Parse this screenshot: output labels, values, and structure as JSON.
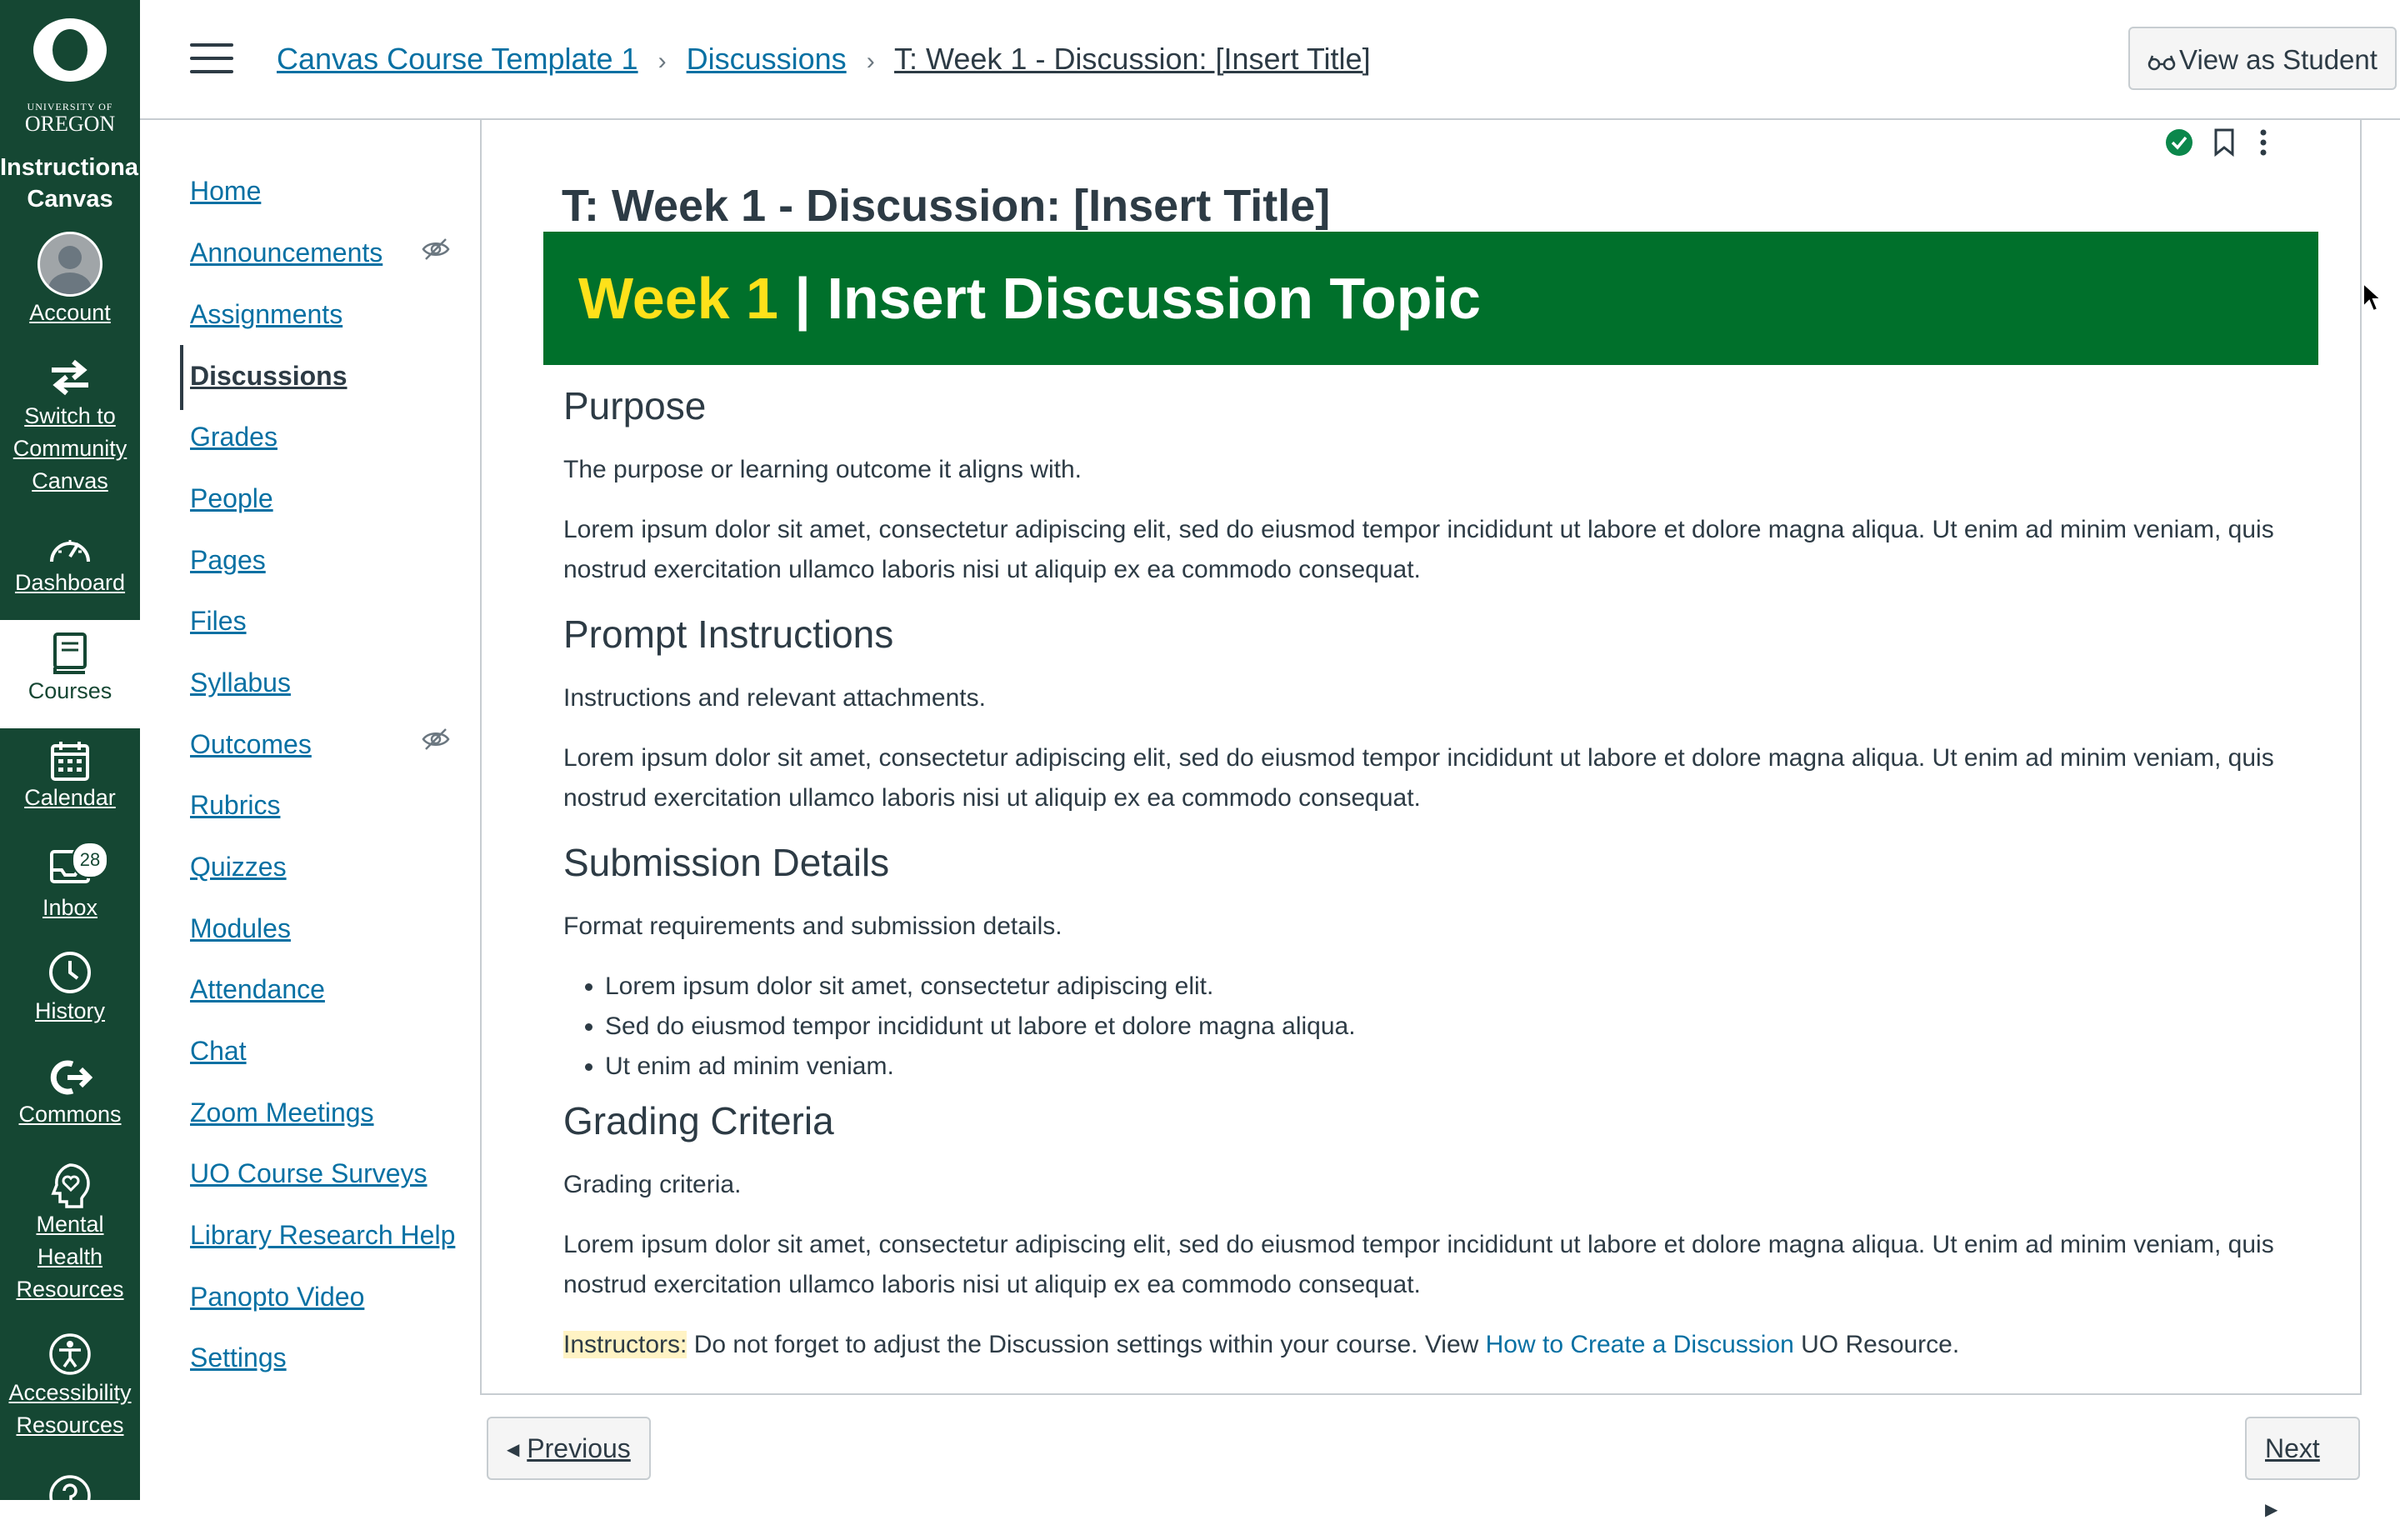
{
  "colors": {
    "nav_bg": "#154733",
    "banner_bg": "#00702b",
    "week_accent": "#fee11a",
    "link": "#0770a3"
  },
  "global_nav": {
    "logo_small": "UNIVERSITY OF",
    "logo_big": "OREGON",
    "brand_line1": "Instructional",
    "brand_line2": "Canvas",
    "items": [
      {
        "label": "Account",
        "icon": "user-avatar-icon"
      },
      {
        "label_lines": [
          "Switch to",
          "Community",
          "Canvas"
        ],
        "icon": "switch-arrows-icon"
      },
      {
        "label": "Dashboard",
        "icon": "dashboard-gauge-icon"
      },
      {
        "label": "Courses",
        "icon": "courses-book-icon",
        "active": true
      },
      {
        "label": "Calendar",
        "icon": "calendar-icon"
      },
      {
        "label": "Inbox",
        "icon": "inbox-icon",
        "badge": "28"
      },
      {
        "label": "History",
        "icon": "clock-icon"
      },
      {
        "label": "Commons",
        "icon": "commons-icon"
      },
      {
        "label_lines": [
          "Mental",
          "Health",
          "Resources"
        ],
        "icon": "heart-head-icon"
      },
      {
        "label_lines": [
          "Accessibility",
          "Resources"
        ],
        "icon": "accessibility-icon"
      },
      {
        "icon": "help-icon"
      }
    ]
  },
  "header": {
    "breadcrumb": [
      "Canvas Course Template 1",
      "Discussions",
      "T: Week 1 - Discussion: [Insert Title]"
    ],
    "view_as_student": "View as Student"
  },
  "course_nav": [
    {
      "label": "Home"
    },
    {
      "label": "Announcements",
      "hidden": true
    },
    {
      "label": "Assignments"
    },
    {
      "label": "Discussions",
      "active": true
    },
    {
      "label": "Grades"
    },
    {
      "label": "People"
    },
    {
      "label": "Pages"
    },
    {
      "label": "Files"
    },
    {
      "label": "Syllabus"
    },
    {
      "label": "Outcomes",
      "hidden": true
    },
    {
      "label": "Rubrics"
    },
    {
      "label": "Quizzes"
    },
    {
      "label": "Modules"
    },
    {
      "label": "Attendance"
    },
    {
      "label": "Chat"
    },
    {
      "label": "Zoom Meetings"
    },
    {
      "label": "UO Course Surveys"
    },
    {
      "label": "Library Research Help"
    },
    {
      "label": "Panopto Video"
    },
    {
      "label": "Settings"
    }
  ],
  "content": {
    "title": "T: Week 1 - Discussion: [Insert Title]",
    "banner_week": "Week 1",
    "banner_rest": " | Insert Discussion Topic",
    "purpose_heading": "Purpose",
    "purpose_text": "The purpose or learning outcome it aligns with.",
    "purpose_lorem": "Lorem ipsum dolor sit amet, consectetur adipiscing elit, sed do eiusmod tempor incididunt ut labore et dolore magna aliqua. Ut enim ad minim veniam, quis nostrud exercitation ullamco laboris nisi ut aliquip ex ea commodo consequat.",
    "prompt_heading": "Prompt Instructions",
    "prompt_text": "Instructions and relevant attachments.",
    "prompt_lorem": "Lorem ipsum dolor sit amet, consectetur adipiscing elit, sed do eiusmod tempor incididunt ut labore et dolore magna aliqua. Ut enim ad minim veniam, quis nostrud exercitation ullamco laboris nisi ut aliquip ex ea commodo consequat.",
    "submission_heading": "Submission Details",
    "submission_text": "Format requirements and submission details.",
    "submission_bullets": [
      "Lorem ipsum dolor sit amet, consectetur adipiscing elit.",
      "Sed do eiusmod tempor incididunt ut labore et dolore magna aliqua.",
      "Ut enim ad minim veniam."
    ],
    "grading_heading": "Grading Criteria",
    "grading_text": "Grading criteria.",
    "grading_lorem": "Lorem ipsum dolor sit amet, consectetur adipiscing elit, sed do eiusmod tempor incididunt ut labore et dolore magna aliqua. Ut enim ad minim veniam, quis nostrud exercitation ullamco laboris nisi ut aliquip ex ea commodo consequat.",
    "note_label": "Instructors:",
    "note_text": " Do not forget to adjust the Discussion settings within your course. View ",
    "note_link": "How to Create a Discussion",
    "note_tail": " UO Resource."
  },
  "footer": {
    "previous": "Previous",
    "next": "Next"
  }
}
